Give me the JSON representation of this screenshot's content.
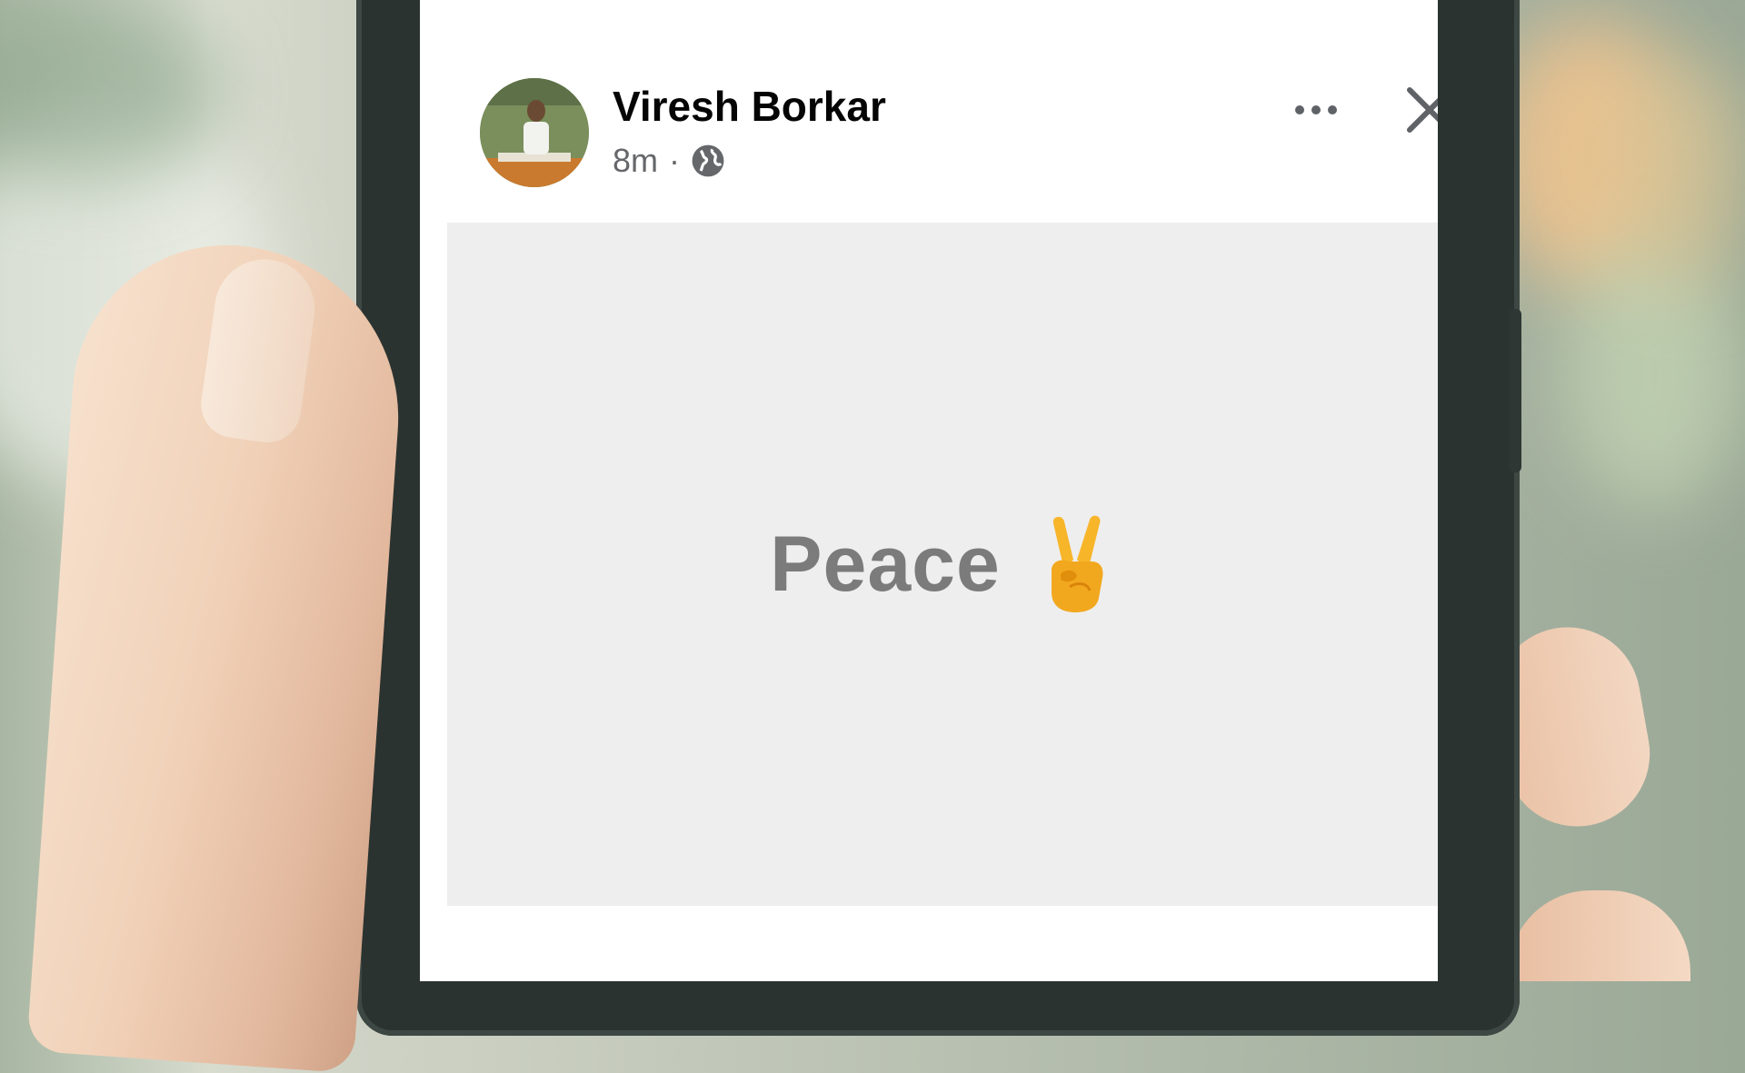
{
  "post": {
    "author_name": "Viresh Borkar",
    "time": "8m",
    "separator": "·",
    "privacy_icon": "globe-icon",
    "text": "Peace",
    "emoji_icon": "victory-hand-emoji"
  },
  "actions": {
    "more_icon": "more-horizontal-icon",
    "close_icon": "close-icon"
  },
  "colors": {
    "card_background": "#eeeeee",
    "post_text": "#7b7b7b",
    "author_text": "#050505",
    "meta_text": "#65676b"
  }
}
